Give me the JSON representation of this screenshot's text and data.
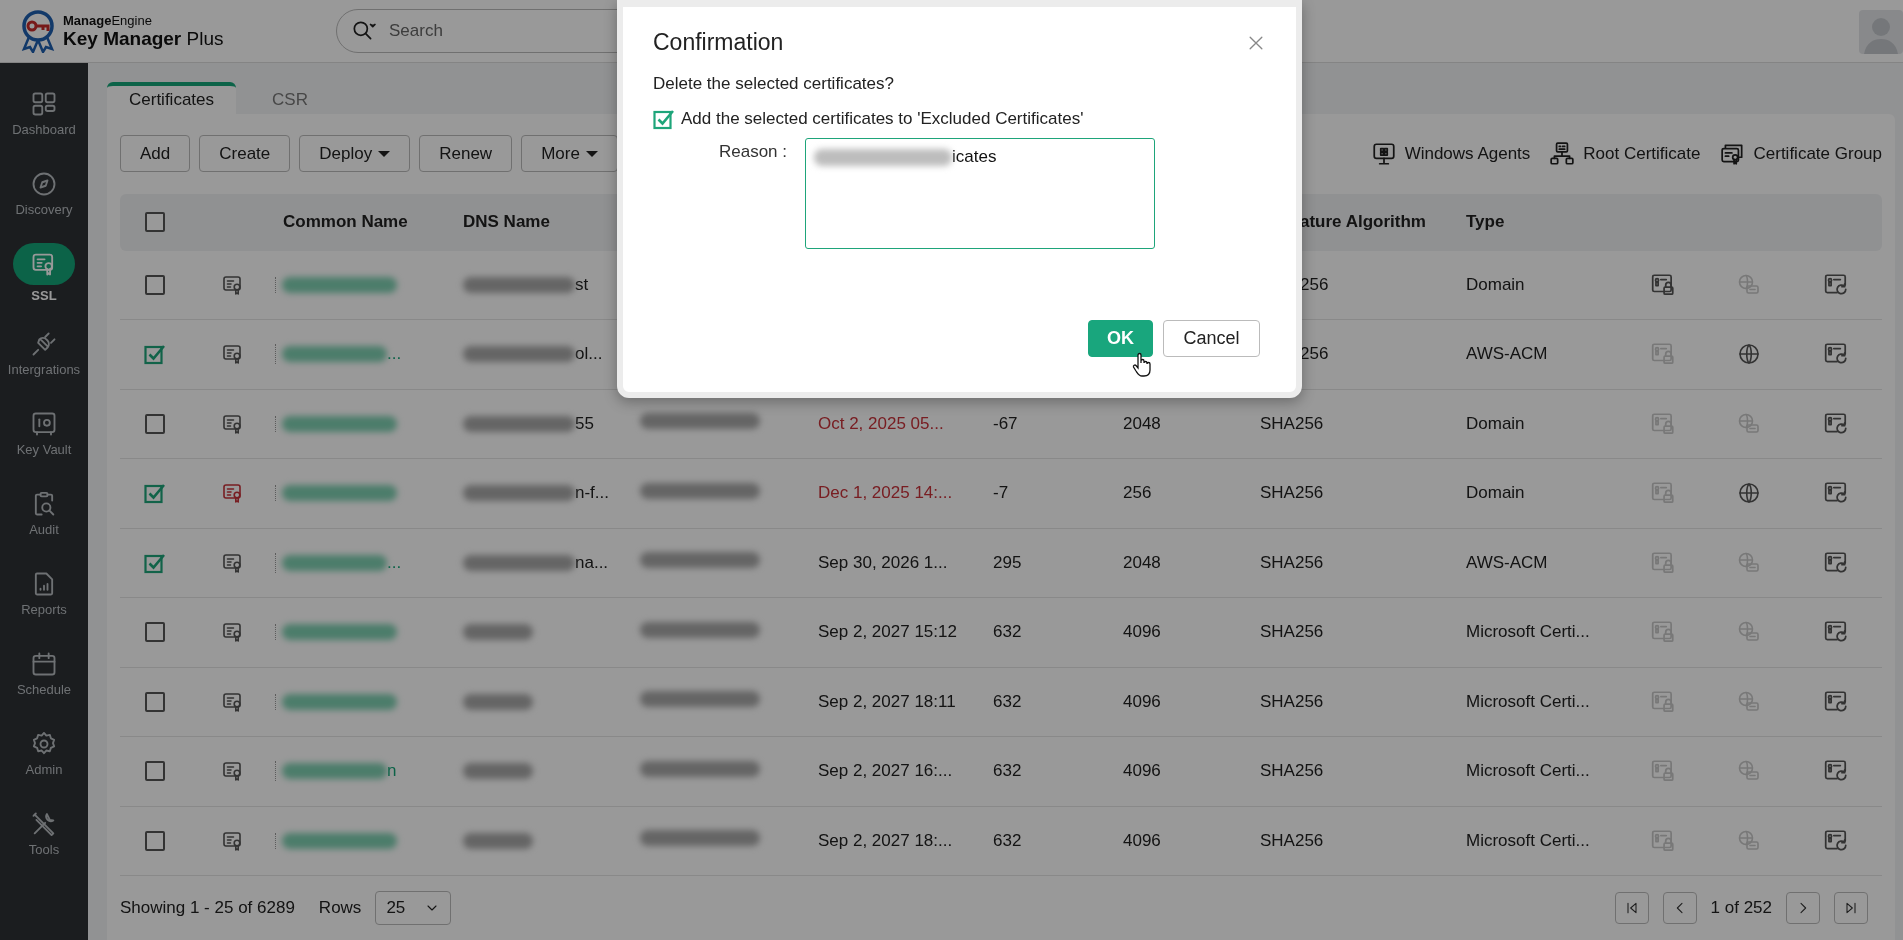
{
  "brand": {
    "company": "**Manage**Engine",
    "product": "**Key Manager** Plus"
  },
  "search": {
    "placeholder": "Search"
  },
  "sidebar": {
    "items": [
      {
        "label": "Dashboard",
        "kind": "dashboard",
        "selected": false
      },
      {
        "label": "Discovery",
        "kind": "discovery",
        "selected": false
      },
      {
        "label": "SSL",
        "kind": "ssl",
        "selected": true
      },
      {
        "label": "Intergrations",
        "kind": "integrations",
        "selected": false
      },
      {
        "label": "Key Vault",
        "kind": "vault",
        "selected": false
      },
      {
        "label": "Audit",
        "kind": "audit",
        "selected": false
      },
      {
        "label": "Reports",
        "kind": "reports",
        "selected": false
      },
      {
        "label": "Schedule",
        "kind": "schedule",
        "selected": false
      },
      {
        "label": "Admin",
        "kind": "admin",
        "selected": false
      },
      {
        "label": "Tools",
        "kind": "tools",
        "selected": false
      }
    ]
  },
  "tabs": [
    {
      "label": "Certificates",
      "selected": true
    },
    {
      "label": "CSR",
      "selected": false
    }
  ],
  "toolbar": {
    "buttons": [
      {
        "label": "Add",
        "kind": "plain"
      },
      {
        "label": "Create",
        "kind": "plain"
      },
      {
        "label": "Deploy",
        "kind": "dropdown"
      },
      {
        "label": "Renew",
        "kind": "plain"
      },
      {
        "label": "More",
        "kind": "dropdown"
      }
    ],
    "links": [
      {
        "label": "Windows Agents",
        "kind": "agents"
      },
      {
        "label": "Root Certificate",
        "kind": "root"
      },
      {
        "label": "Certificate Group",
        "kind": "group"
      }
    ]
  },
  "table": {
    "select_all": {
      "checked": false
    },
    "columns": [
      {
        "kind": "common_name",
        "label": "Common Name"
      },
      {
        "kind": "dns_name",
        "label": "DNS Name"
      },
      {
        "kind": "signature",
        "label": "ature Algorithm"
      },
      {
        "kind": "type",
        "label": "Type"
      }
    ],
    "rows": [
      {
        "selected": false,
        "icon_alert": false,
        "dns_name": "st",
        "signature": "256",
        "type": "Domain",
        "lock_enabled": true,
        "dns_enabled": false
      },
      {
        "selected": true,
        "icon_alert": false,
        "common_name": "...",
        "dns_name": "ol...",
        "signature": "256",
        "type": "AWS-ACM",
        "lock_enabled": false,
        "dns_enabled": true
      },
      {
        "selected": false,
        "icon_alert": false,
        "dns_name": "55",
        "expiry": "Oct 2, 2025 05...",
        "date_alert": true,
        "days": "-67",
        "key_size": "2048",
        "signature": "SHA256",
        "type": "Domain",
        "lock_enabled": false,
        "dns_enabled": false
      },
      {
        "selected": true,
        "icon_alert": true,
        "dns_name": "n-f...",
        "expiry": "Dec 1, 2025 14:...",
        "date_alert": true,
        "days": "-7",
        "key_size": "256",
        "signature": "SHA256",
        "type": "Domain",
        "lock_enabled": false,
        "dns_enabled": true
      },
      {
        "selected": true,
        "icon_alert": false,
        "common_name": "...",
        "dns_name": "na...",
        "expiry": "Sep 30, 2026 1...",
        "date_alert": false,
        "days": "295",
        "key_size": "2048",
        "signature": "SHA256",
        "type": "AWS-ACM",
        "lock_enabled": false,
        "dns_enabled": false
      },
      {
        "selected": false,
        "icon_alert": false,
        "expiry": "Sep 2, 2027 15:12",
        "date_alert": false,
        "days": "632",
        "key_size": "4096",
        "signature": "SHA256",
        "type": "Microsoft Certi...",
        "lock_enabled": false,
        "dns_enabled": false
      },
      {
        "selected": false,
        "icon_alert": false,
        "expiry": "Sep 2, 2027 18:11",
        "date_alert": false,
        "days": "632",
        "key_size": "4096",
        "signature": "SHA256",
        "type": "Microsoft Certi...",
        "lock_enabled": false,
        "dns_enabled": false
      },
      {
        "selected": false,
        "icon_alert": false,
        "common_name": "n",
        "expiry": "Sep 2, 2027 16:...",
        "date_alert": false,
        "days": "632",
        "key_size": "4096",
        "signature": "SHA256",
        "type": "Microsoft Certi...",
        "lock_enabled": false,
        "dns_enabled": false
      },
      {
        "selected": false,
        "icon_alert": false,
        "expiry": "Sep 2, 2027 18:...",
        "date_alert": false,
        "days": "632",
        "key_size": "4096",
        "signature": "SHA256",
        "type": "Microsoft Certi...",
        "lock_enabled": false,
        "dns_enabled": false
      }
    ]
  },
  "footer": {
    "showing": "Showing 1 - 25 of 6289",
    "rows_label": "Rows",
    "rows_value": "25",
    "page": "1 of 252"
  },
  "dialog": {
    "title": "Confirmation",
    "message": "Delete the selected certificates?",
    "exclude": {
      "label": "Add the selected certificates to 'Excluded Certificates'",
      "checked": true
    },
    "reason_label": "Reason :",
    "reason_value": "icates",
    "buttons": [
      {
        "label": "OK",
        "kind": "primary"
      },
      {
        "label": "Cancel",
        "kind": "secondary"
      }
    ]
  }
}
